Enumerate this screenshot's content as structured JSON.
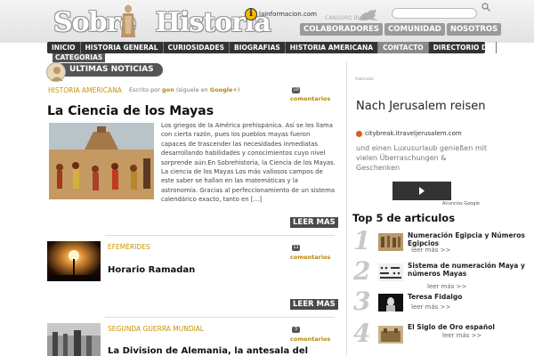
{
  "header": {
    "logo_word1": "Sobre",
    "logo_word2": "Historia",
    "info_brand": "lainformacion.com",
    "info_letter": "i",
    "blogs_label": "CANGURO BLOGS",
    "top_links": [
      "COLABORADORES",
      "COMUNIDAD",
      "NOSOTROS"
    ]
  },
  "nav": {
    "items": [
      "INICIO",
      "HISTORIA GENERAL",
      "CURIOSIDADES",
      "BIOGRAFIAS",
      "HISTORIA AMERICANA",
      "CONTACTO",
      "DIRECTORIO DE"
    ],
    "overflow_label": "CATEGORIAS",
    "active_index": 5
  },
  "section": {
    "title": "ULTIMAS NOTICIAS"
  },
  "posts": [
    {
      "category": "HISTORIA AMERICANA",
      "byline_prefix": "Escrito por",
      "author": "gon",
      "byline_follow": "(siguele en",
      "byline_network": "Google+",
      "byline_close": ")",
      "comment_count": "10",
      "comment_label": "comentarios",
      "title": "La Ciencia de los Mayas",
      "excerpt": "Los griegos de la América prehispánica. Así se les llama con cierta razón, pues los pueblos mayas fueron capaces de trascender las necesidades inmediatas desarrollando habilidades y conocimientos cuyo nivel sorprende aún.En Sobrehistoria, la Ciencia de los Mayas. La ciencia de los Mayas Los más valiosos campos de este saber se hallan en las matemáticas y la astronomía. Gracias al perfeccionamiento de un sistema calendárico exacto, tanto en […]",
      "read_more": "LEER MAS"
    },
    {
      "category": "EFEMÉRIDES",
      "comment_count": "11",
      "comment_label": "comentarios",
      "title": "Horario Ramadan",
      "read_more": "LEER MAS"
    },
    {
      "category": "SEGUNDA GUERRA MUNDIAL",
      "comment_count": "3",
      "comment_label": "comentarios",
      "title": "La Division de Alemania, la antesala del"
    }
  ],
  "sidebar": {
    "ad_label": "Publicidad",
    "ad_title": "Nach Jerusalem reisen",
    "ad_site": "citybreak.itraveljerusalem.com",
    "ad_text": "und einen Luxusurlaub genießen mit vielen Überraschungen & Geschenken",
    "ad_footer": "Anuncios Google",
    "top5_title": "Top 5 de articulos",
    "top5": [
      {
        "rank": "1",
        "title": "Numeración Egipcia y Números Egipcios",
        "leer": "leer más >>"
      },
      {
        "rank": "2",
        "title": "Sistema de numeración Maya y números Mayas",
        "leer": "leer más >>"
      },
      {
        "rank": "3",
        "title": "Teresa Fidalgo",
        "leer": "leer más >>"
      },
      {
        "rank": "4",
        "title": "El Siglo de Oro español",
        "leer": "leer más >>"
      }
    ]
  }
}
